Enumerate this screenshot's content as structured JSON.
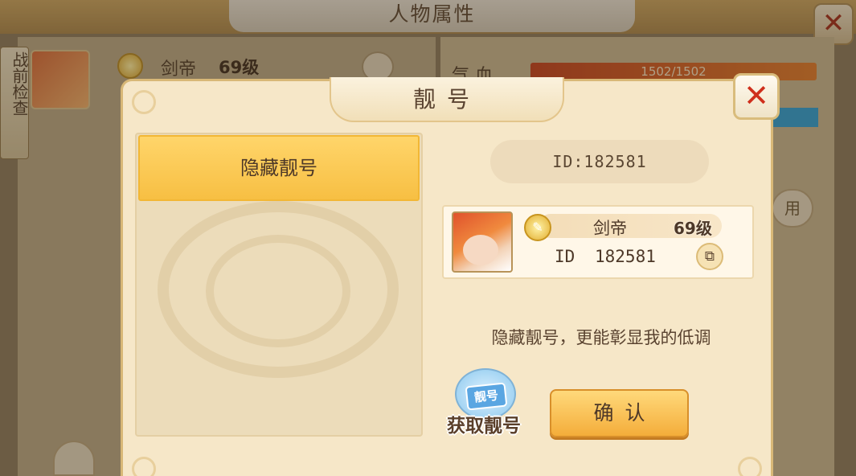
{
  "background": {
    "title": "人物属性",
    "side_tab": "战前检查",
    "player_name": "剑帝",
    "player_level": "69级",
    "hp_label": "气 血",
    "hp_value": "1502/1502",
    "use_button_fragment": "用",
    "close_glyph": "✕"
  },
  "modal": {
    "title": "靓号",
    "close_glyph": "✕",
    "list": {
      "items": [
        "隐藏靓号"
      ],
      "selected_index": 0
    },
    "id_display": "ID:182581",
    "card": {
      "name": "剑帝",
      "level": "69级",
      "id_label": "ID",
      "id_value": "182581"
    },
    "description": "隐藏靓号，更能彰显我的低调",
    "get_ticket_text": "靓号",
    "get_label": "获取靓号",
    "confirm_label": "确认"
  },
  "icons": {
    "copy": "⧉",
    "coin": "✎"
  },
  "colors": {
    "accent_gold": "#f7bf43",
    "close_red": "#cf2f1c",
    "panel_cream": "#f6e7c8",
    "hp_bar": "#c2401e"
  }
}
